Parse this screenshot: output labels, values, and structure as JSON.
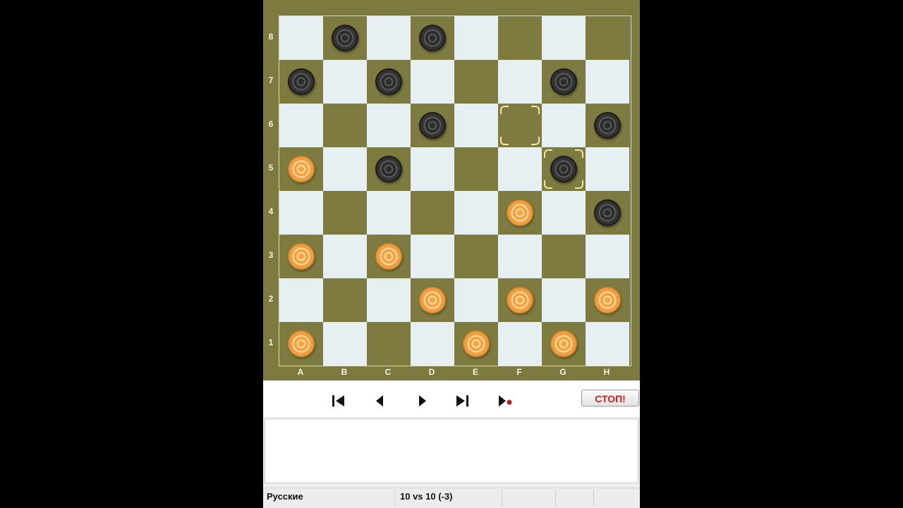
{
  "board": {
    "ranks": [
      "8",
      "7",
      "6",
      "5",
      "4",
      "3",
      "2",
      "1"
    ],
    "files": [
      "A",
      "B",
      "C",
      "D",
      "E",
      "F",
      "G",
      "H"
    ],
    "colors": {
      "light": "#e6f0f3",
      "dark": "#7d7b3f",
      "frame": "#7c7a3e"
    },
    "pieces": [
      {
        "square": "b8",
        "color": "black"
      },
      {
        "square": "d8",
        "color": "black"
      },
      {
        "square": "a7",
        "color": "black"
      },
      {
        "square": "c7",
        "color": "black"
      },
      {
        "square": "g7",
        "color": "black"
      },
      {
        "square": "d6",
        "color": "black"
      },
      {
        "square": "h6",
        "color": "black"
      },
      {
        "square": "a5",
        "color": "white"
      },
      {
        "square": "c5",
        "color": "black"
      },
      {
        "square": "g5",
        "color": "black"
      },
      {
        "square": "f4",
        "color": "white"
      },
      {
        "square": "h4",
        "color": "black"
      },
      {
        "square": "a3",
        "color": "white"
      },
      {
        "square": "c3",
        "color": "white"
      },
      {
        "square": "d2",
        "color": "white"
      },
      {
        "square": "f2",
        "color": "white"
      },
      {
        "square": "h2",
        "color": "white"
      },
      {
        "square": "a1",
        "color": "white"
      },
      {
        "square": "e1",
        "color": "white"
      },
      {
        "square": "g1",
        "color": "white"
      }
    ],
    "last_move_highlight": [
      "f6",
      "g5"
    ]
  },
  "controls": {
    "nav_buttons": [
      "first-move-icon",
      "prev-move-icon",
      "next-move-icon",
      "last-move-icon",
      "play-record-icon"
    ],
    "stop_label": "СТОП!"
  },
  "status": {
    "game_type": "Русские",
    "score": "10 vs 10  (-3)"
  }
}
